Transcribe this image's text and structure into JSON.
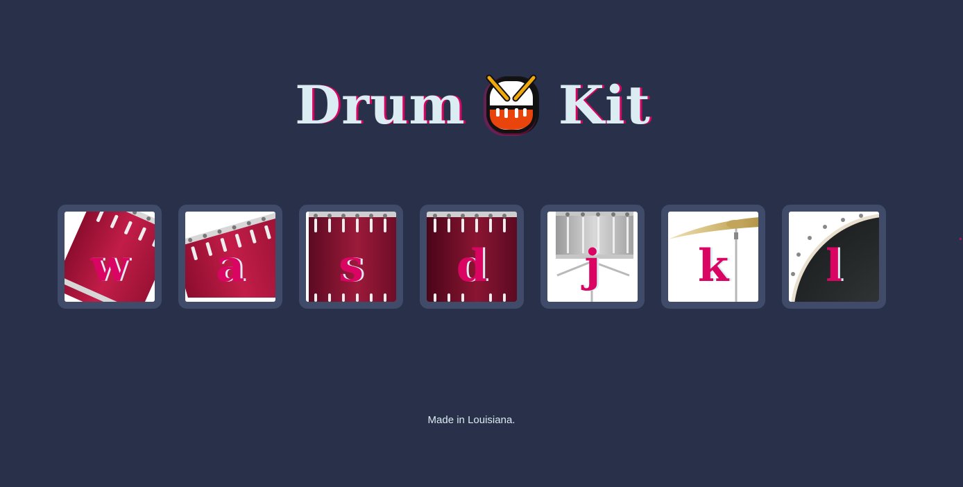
{
  "header": {
    "title_left": "Drum",
    "title_right": "Kit",
    "icon": "drum-emoji-icon"
  },
  "pads": [
    {
      "key": "w",
      "icon": "tom-drum-icon"
    },
    {
      "key": "a",
      "icon": "tom-drum-icon"
    },
    {
      "key": "s",
      "icon": "floor-tom-icon"
    },
    {
      "key": "d",
      "icon": "floor-tom-icon"
    },
    {
      "key": "j",
      "icon": "snare-drum-icon"
    },
    {
      "key": "k",
      "icon": "crash-cymbal-icon"
    },
    {
      "key": "l",
      "icon": "kick-drum-icon"
    }
  ],
  "footer": {
    "text": "Made in Louisiana."
  },
  "colors": {
    "background": "#283149",
    "pad_frame": "#404b69",
    "accent": "#da0463",
    "light": "#dbedf3"
  }
}
